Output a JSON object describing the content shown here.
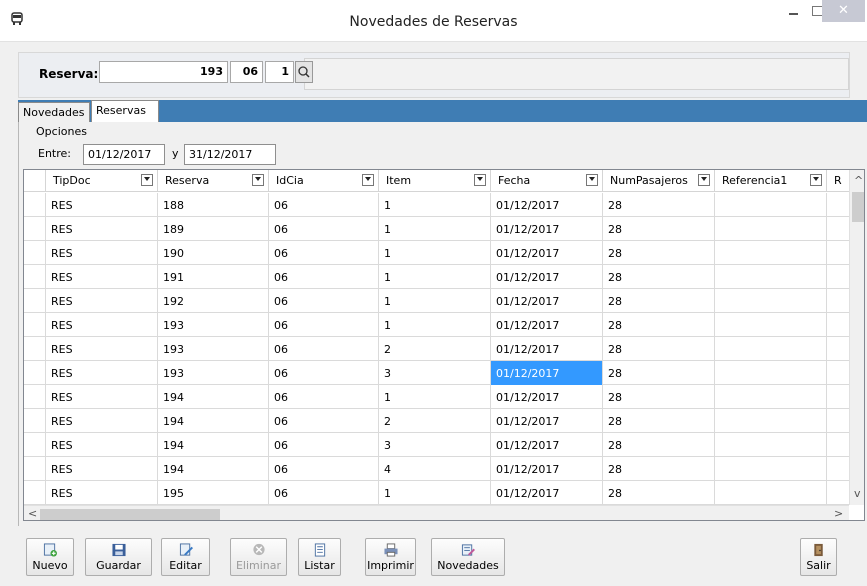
{
  "window": {
    "title": "Novedades de Reservas"
  },
  "reserva": {
    "label": "Reserva:",
    "numero": "193",
    "cia": "06",
    "item": "1"
  },
  "tabs": [
    {
      "label": "Novedades"
    },
    {
      "label": "Reservas"
    }
  ],
  "opciones": {
    "label": "Opciones",
    "entre_label": "Entre:",
    "desde": "01/12/2017",
    "y_label": "y",
    "hasta": "31/12/2017"
  },
  "grid": {
    "columns": [
      "TipDoc",
      "Reserva",
      "IdCia",
      "Item",
      "Fecha",
      "NumPasajeros",
      "Referencia1",
      "R"
    ],
    "rows": [
      [
        "RES",
        "188",
        "06",
        "1",
        "01/12/2017",
        "28",
        ""
      ],
      [
        "RES",
        "189",
        "06",
        "1",
        "01/12/2017",
        "28",
        ""
      ],
      [
        "RES",
        "190",
        "06",
        "1",
        "01/12/2017",
        "28",
        ""
      ],
      [
        "RES",
        "191",
        "06",
        "1",
        "01/12/2017",
        "28",
        ""
      ],
      [
        "RES",
        "192",
        "06",
        "1",
        "01/12/2017",
        "28",
        ""
      ],
      [
        "RES",
        "193",
        "06",
        "1",
        "01/12/2017",
        "28",
        ""
      ],
      [
        "RES",
        "193",
        "06",
        "2",
        "01/12/2017",
        "28",
        ""
      ],
      [
        "RES",
        "193",
        "06",
        "3",
        "01/12/2017",
        "28",
        ""
      ],
      [
        "RES",
        "194",
        "06",
        "1",
        "01/12/2017",
        "28",
        ""
      ],
      [
        "RES",
        "194",
        "06",
        "2",
        "01/12/2017",
        "28",
        ""
      ],
      [
        "RES",
        "194",
        "06",
        "3",
        "01/12/2017",
        "28",
        ""
      ],
      [
        "RES",
        "194",
        "06",
        "4",
        "01/12/2017",
        "28",
        ""
      ],
      [
        "RES",
        "195",
        "06",
        "1",
        "01/12/2017",
        "28",
        ""
      ]
    ],
    "selected_row": 7,
    "selected_col": 4
  },
  "toolbar": [
    {
      "label": "Nuevo",
      "icon": "new-icon",
      "enabled": true
    },
    {
      "label": "Guardar",
      "icon": "save-icon",
      "enabled": true
    },
    {
      "label": "Editar",
      "icon": "edit-icon",
      "enabled": true
    },
    {
      "label": "Eliminar",
      "icon": "delete-icon",
      "enabled": false
    },
    {
      "label": "Listar",
      "icon": "list-icon",
      "enabled": true
    },
    {
      "label": "Imprimir",
      "icon": "print-icon",
      "enabled": true
    },
    {
      "label": "Novedades",
      "icon": "novedades-icon",
      "enabled": true
    },
    {
      "label": "Salir",
      "icon": "exit-icon",
      "enabled": true
    }
  ],
  "colors": {
    "tab_strip": "#3f7db4",
    "selection": "#3399ff",
    "close_button": "#c7c9d4"
  }
}
